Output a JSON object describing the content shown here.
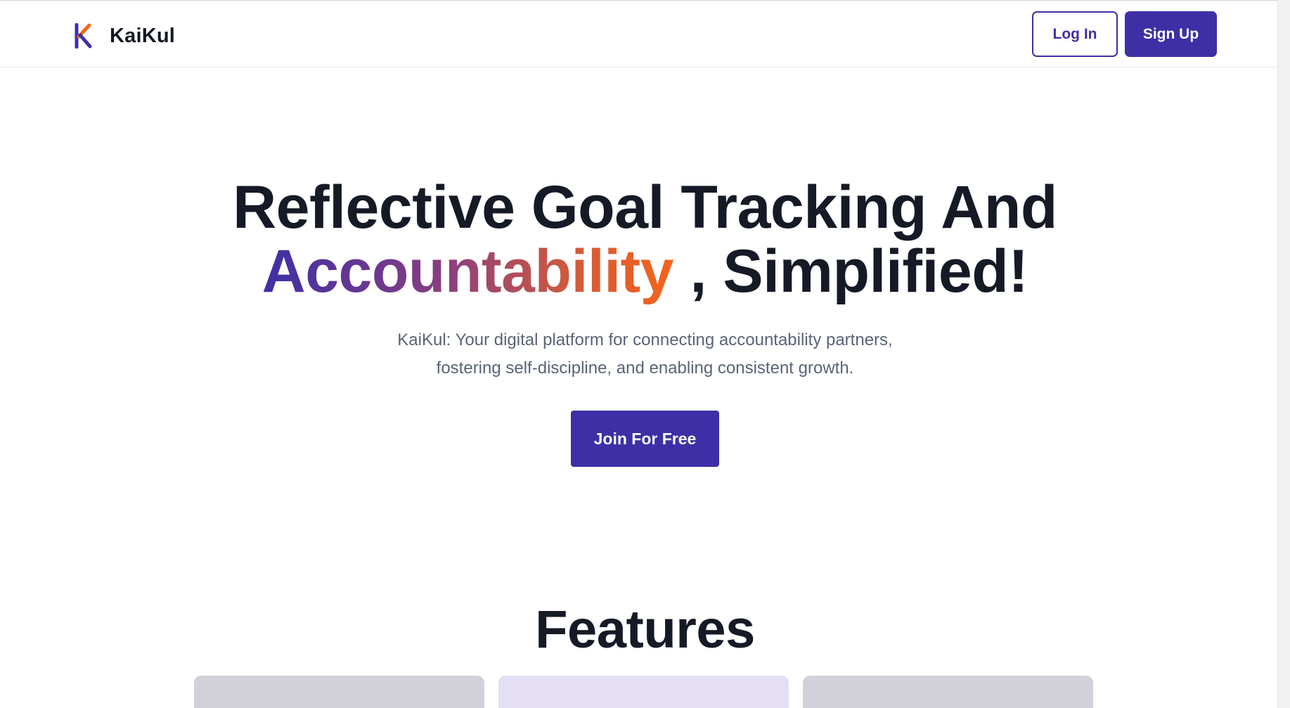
{
  "app": {
    "brand_name": "KaiKul",
    "colors": {
      "primary": "#3e2fa6",
      "accent_orange": "#f4641a",
      "text_dark": "#161a26",
      "text_muted": "#5a6478",
      "card_gray": "#d2d0d8",
      "card_lavender": "#e4dff5"
    }
  },
  "navbar": {
    "login_label": "Log In",
    "signup_label": "Sign Up"
  },
  "hero": {
    "title_line1": "Reflective Goal Tracking And",
    "title_highlight": "Accountability",
    "title_rest": " , Simplified!",
    "subtitle_line1": "KaiKul: Your digital platform for connecting accountability partners,",
    "subtitle_line2": "fostering self-discipline, and enabling consistent growth.",
    "cta_label": "Join For Free"
  },
  "features": {
    "title": "Features",
    "cards": [
      {
        "icon": "feature-icon"
      },
      {
        "icon": "feature-icon"
      },
      {
        "icon": "feature-icon"
      }
    ]
  }
}
